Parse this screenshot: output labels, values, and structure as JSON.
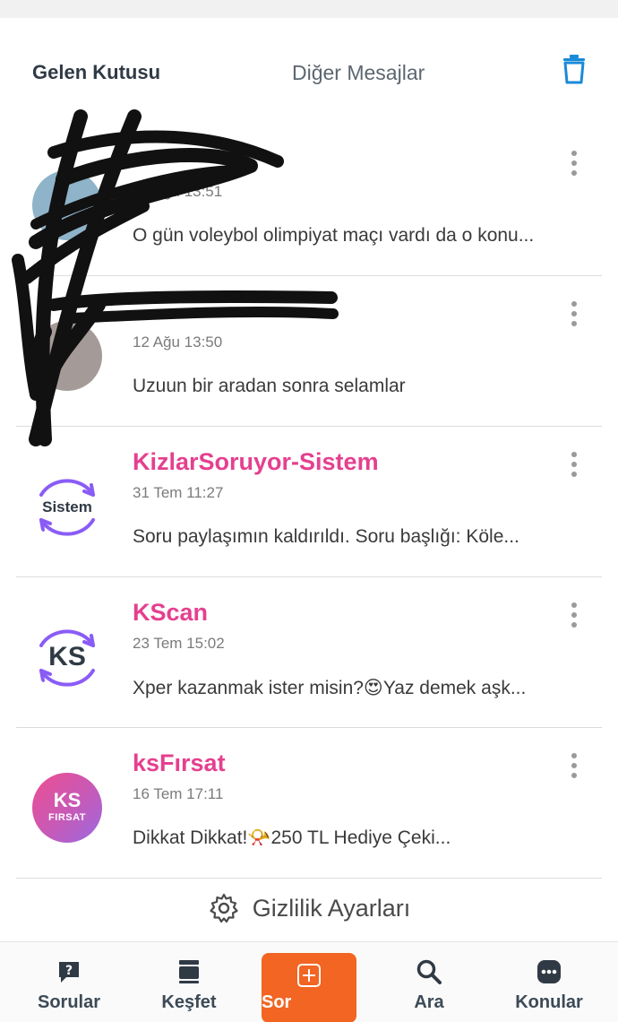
{
  "tabs": {
    "inbox": "Gelen Kutusu",
    "other": "Diğer Mesajlar"
  },
  "colors": {
    "accent_pink": "#e5408f",
    "accent_orange": "#f26522",
    "trash_blue": "#1a8ad8"
  },
  "messages": [
    {
      "sender": "",
      "date": "12 Ağu 13:51",
      "preview": "O gün voleybol olimpiyat maçı vardı da o konu..."
    },
    {
      "sender": "",
      "date": "12 Ağu 13:50",
      "preview": "Uzuun bir aradan sonra selamlar"
    },
    {
      "sender": "KizlarSoruyor-Sistem",
      "date": "31 Tem 11:27",
      "preview": "Soru paylaşımın kaldırıldı. Soru başlığı: Köle...",
      "avatar_text": "Sistem"
    },
    {
      "sender": "KScan",
      "date": "23 Tem 15:02",
      "preview": "Xper kazanmak ister misin?😍Yaz demek aşk...",
      "avatar_text": "KS"
    },
    {
      "sender": "ksFırsat",
      "date": "16 Tem 17:11",
      "preview": "Dikkat Dikkat!📯250 TL Hediye Çeki...",
      "avatar_text": "KS",
      "avatar_subtext": "FIRSAT"
    }
  ],
  "privacy": {
    "label": "Gizlilik Ayarları"
  },
  "nav": {
    "questions": "Sorular",
    "explore": "Keşfet",
    "ask": "Sor",
    "search": "Ara",
    "topics": "Konular"
  }
}
